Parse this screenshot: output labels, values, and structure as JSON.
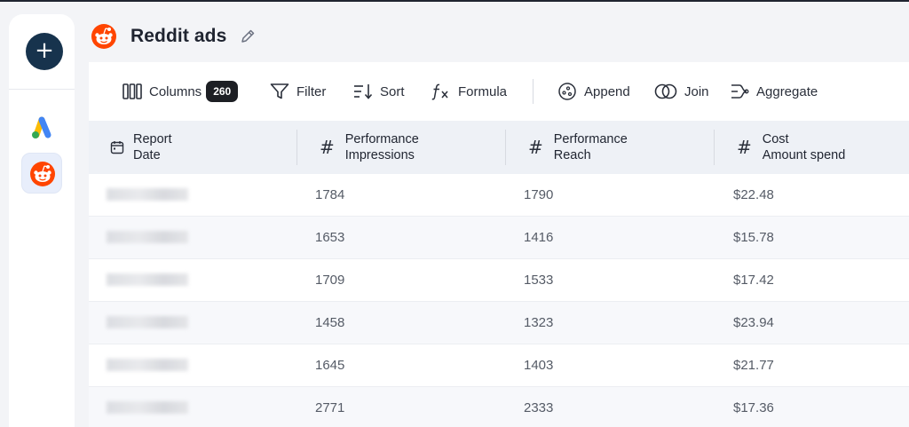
{
  "header": {
    "title": "Reddit ads"
  },
  "toolbar": {
    "columns_label": "Columns",
    "columns_count": "260",
    "filter_label": "Filter",
    "sort_label": "Sort",
    "formula_label": "Formula",
    "append_label": "Append",
    "join_label": "Join",
    "aggregate_label": "Aggregate"
  },
  "table": {
    "columns": [
      {
        "line1": "Report",
        "line2": "Date",
        "icon": "calendar-icon"
      },
      {
        "line1": "Performance",
        "line2": "Impressions",
        "icon": "hash-icon"
      },
      {
        "line1": "Performance",
        "line2": "Reach",
        "icon": "hash-icon"
      },
      {
        "line1": "Cost",
        "line2": "Amount spend",
        "icon": "hash-icon"
      }
    ],
    "hash_symbol": "#",
    "rows": [
      {
        "impressions": "1784",
        "reach": "1790",
        "spend": "$22.48"
      },
      {
        "impressions": "1653",
        "reach": "1416",
        "spend": "$15.78"
      },
      {
        "impressions": "1709",
        "reach": "1533",
        "spend": "$17.42"
      },
      {
        "impressions": "1458",
        "reach": "1323",
        "spend": "$23.94"
      },
      {
        "impressions": "1645",
        "reach": "1403",
        "spend": "$21.77"
      },
      {
        "impressions": "2771",
        "reach": "2333",
        "spend": "$17.36"
      }
    ]
  },
  "sidebar": {
    "add_symbol": "+"
  },
  "colors": {
    "reddit": "#ff4500",
    "navy": "#17334d",
    "badge": "#1d1f24"
  }
}
